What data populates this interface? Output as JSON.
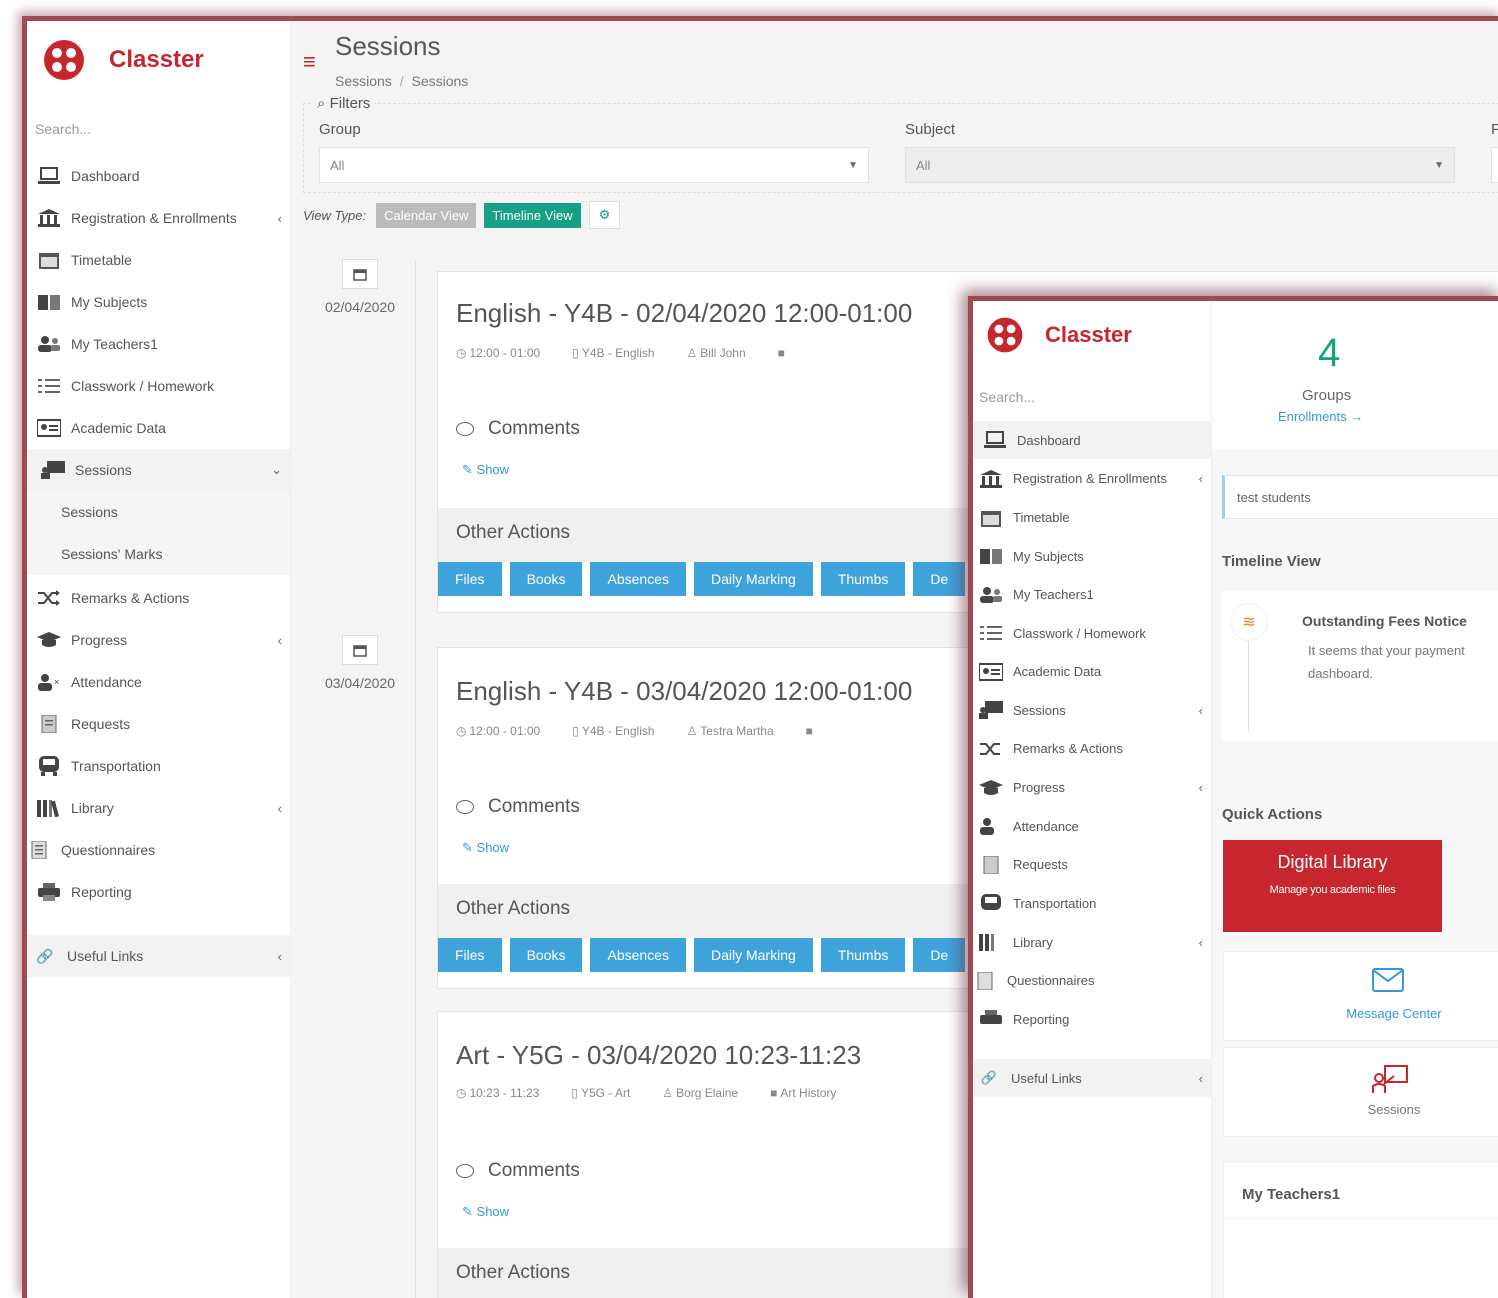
{
  "brand": {
    "name": "Classter",
    "color": "#c8262e"
  },
  "sidebar": {
    "search_placeholder": "Search...",
    "items": [
      {
        "label": "Dashboard",
        "icon": "laptop-icon"
      },
      {
        "label": "Registration & Enrollments",
        "icon": "institution-icon",
        "has_children": true
      },
      {
        "label": "Timetable",
        "icon": "calendar-icon"
      },
      {
        "label": "My Subjects",
        "icon": "book-icon"
      },
      {
        "label": "My Teachers1",
        "icon": "users-icon"
      },
      {
        "label": "Classwork / Homework",
        "icon": "list-icon"
      },
      {
        "label": "Academic Data",
        "icon": "id-card-icon"
      },
      {
        "label": "Sessions",
        "icon": "presentation-icon",
        "has_children": true
      },
      {
        "label": "Remarks & Actions",
        "icon": "shuffle-icon"
      },
      {
        "label": "Progress",
        "icon": "graduation-cap-icon",
        "has_children": true
      },
      {
        "label": "Attendance",
        "icon": "user-times-icon"
      },
      {
        "label": "Requests",
        "icon": "document-icon"
      },
      {
        "label": "Transportation",
        "icon": "bus-icon"
      },
      {
        "label": "Library",
        "icon": "library-icon",
        "has_children": true
      },
      {
        "label": "Questionnaires",
        "icon": "clipboard-icon"
      },
      {
        "label": "Reporting",
        "icon": "printer-icon"
      },
      {
        "label": "Useful Links",
        "icon": "link-icon",
        "has_children": true
      }
    ],
    "sessions_sub": [
      "Sessions",
      "Sessions' Marks"
    ]
  },
  "header": {
    "title": "Sessions",
    "breadcrumb": [
      "Sessions",
      "Sessions"
    ],
    "breadcrumb_sep": "/"
  },
  "filters": {
    "legend": "Filters",
    "group_label": "Group",
    "group_value": "All",
    "subject_label": "Subject",
    "subject_value": "All",
    "third_label_partial": "F"
  },
  "view_type": {
    "label": "View Type:",
    "calendar": "Calendar View",
    "timeline": "Timeline View",
    "settings_glyph": "⚙"
  },
  "sessions": [
    {
      "date": "02/04/2020",
      "title": "English - Y4B - 02/04/2020 12:00-01:00",
      "time": "12:00 - 01:00",
      "group": "Y4B - English",
      "teacher": "Bill John",
      "extra": "",
      "comments_label": "Comments",
      "show_label": "Show",
      "other_actions": "Other Actions",
      "actions": [
        "Files",
        "Books",
        "Absences",
        "Daily Marking",
        "Thumbs",
        "De"
      ]
    },
    {
      "date": "03/04/2020",
      "title": "English - Y4B - 03/04/2020 12:00-01:00",
      "time": "12:00 - 01:00",
      "group": "Y4B - English",
      "teacher": "Testra Martha",
      "extra": "",
      "comments_label": "Comments",
      "show_label": "Show",
      "other_actions": "Other Actions",
      "actions": [
        "Files",
        "Books",
        "Absences",
        "Daily Marking",
        "Thumbs",
        "De"
      ]
    },
    {
      "date": "",
      "title": "Art - Y5G - 03/04/2020 10:23-11:23",
      "time": "10:23 - 11:23",
      "group": "Y5G - Art",
      "teacher": "Borg Elaine",
      "extra": "Art History",
      "comments_label": "Comments",
      "show_label": "Show",
      "other_actions": "Other Actions",
      "actions": []
    }
  ],
  "dashboard": {
    "stat_value": "4",
    "stat_label": "Groups",
    "stat_link": "Enrollments",
    "stat_arrow": "→",
    "search_box": "test students",
    "timeline_title": "Timeline View",
    "notice_title": "Outstanding Fees Notice",
    "notice_line1": "It seems that your payment",
    "notice_line2": "dashboard.",
    "quick_actions_title": "Quick Actions",
    "digital_library_title": "Digital Library",
    "digital_library_sub": "Manage you academic files",
    "message_center": "Message Center",
    "sessions_label": "Sessions",
    "teachers_title": "My Teachers1"
  },
  "colors": {
    "accent_green": "#16a085",
    "action_blue": "#3ea2db",
    "link_blue": "#3498db",
    "frame_border": "#a04a56"
  }
}
